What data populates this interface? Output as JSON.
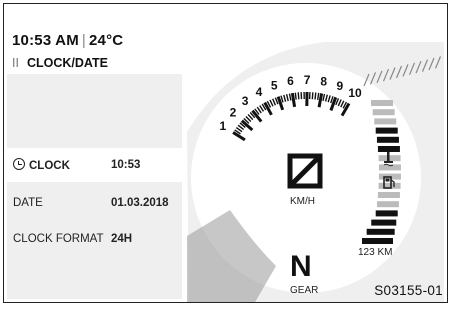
{
  "status": {
    "time": "10:53 AM",
    "temperature": "24°C"
  },
  "menu": {
    "title": "CLOCK/DATE"
  },
  "settings": [
    {
      "label": "CLOCK",
      "value": "10:53"
    },
    {
      "label": "DATE",
      "value": "01.03.2018"
    },
    {
      "label": "CLOCK FORMAT",
      "value": "24H"
    }
  ],
  "tachometer": {
    "ticks": [
      "1",
      "2",
      "3",
      "4",
      "5",
      "6",
      "7",
      "8",
      "9",
      "10"
    ]
  },
  "speed": {
    "unit": "KM/H"
  },
  "gear": {
    "value": "N",
    "label": "GEAR"
  },
  "odometer": {
    "value": "123 KM"
  },
  "figure_ref": "S03155-01"
}
